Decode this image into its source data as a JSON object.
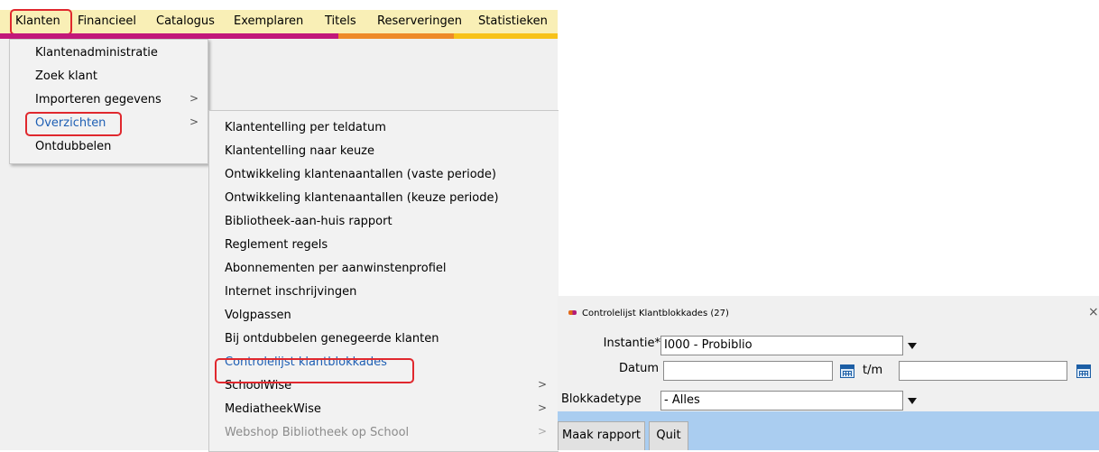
{
  "menubar": {
    "items": [
      "Klanten",
      "Financieel",
      "Catalogus",
      "Exemplaren",
      "Titels",
      "Reserveringen",
      "Statistieken"
    ]
  },
  "accent_colors": [
    "#c2187a",
    "#ee8a2a",
    "#f7c21a"
  ],
  "highlight_color": "#e0282e",
  "klanten_menu": {
    "items": [
      {
        "label": "Klantenadministratie"
      },
      {
        "label": "Zoek klant"
      },
      {
        "label": "Importeren gegevens",
        "submenu_arrow": ">"
      },
      {
        "label": "Overzichten",
        "submenu_arrow": ">"
      },
      {
        "label": "Ontdubbelen"
      }
    ]
  },
  "overzichten_menu": {
    "items": [
      {
        "label": "Klantentelling per teldatum"
      },
      {
        "label": "Klantentelling naar keuze"
      },
      {
        "label": "Ontwikkeling klantenaantallen (vaste periode)"
      },
      {
        "label": "Ontwikkeling klantenaantallen (keuze periode)"
      },
      {
        "label": "Bibliotheek-aan-huis rapport"
      },
      {
        "label": "Reglement regels"
      },
      {
        "label": "Abonnementen per aanwinstenprofiel"
      },
      {
        "label": "Internet inschrijvingen"
      },
      {
        "label": "Volgpassen"
      },
      {
        "label": "Bij ontdubbelen genegeerde klanten"
      },
      {
        "label": "Controlelijst klantblokkades"
      },
      {
        "label": "SchoolWise",
        "submenu_arrow": ">"
      },
      {
        "label": "MediatheekWise",
        "submenu_arrow": ">"
      },
      {
        "label": "Webshop Bibliotheek op School",
        "submenu_arrow": ">"
      }
    ]
  },
  "dialog": {
    "title": "Controlelijst Klantblokkades (27)",
    "close": "×",
    "instantie_label": "Instantie*",
    "instantie_value": "I000 - Probiblio",
    "datum_label": "Datum",
    "datum_from": "",
    "tm_label": "t/m",
    "datum_to": "",
    "blokkadetype_label": "Blokkadetype",
    "blokkadetype_value": "- Alles",
    "buttons": {
      "make_report": "Maak rapport",
      "quit": "Quit"
    }
  }
}
